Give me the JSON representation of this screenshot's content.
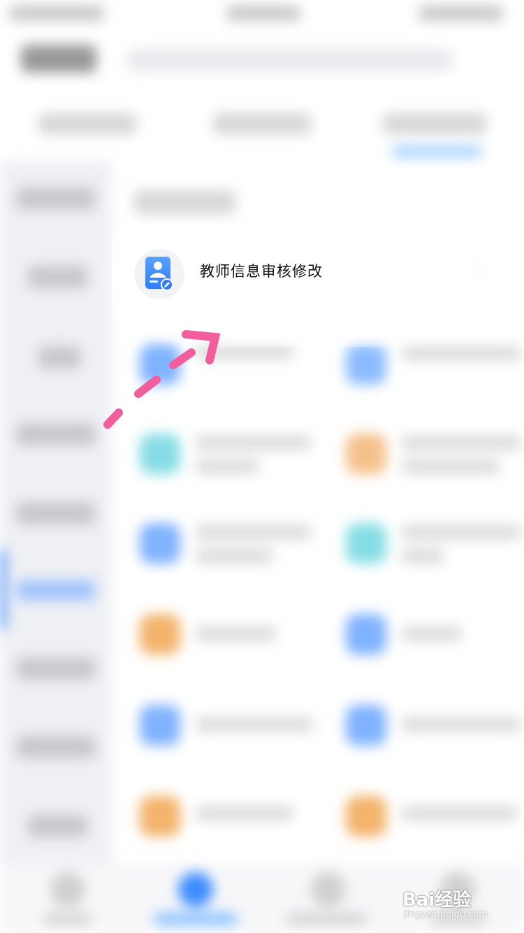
{
  "highlighted_item": {
    "label": "教师信息审核修改",
    "icon": "teacher-profile-edit-icon"
  },
  "annotation": {
    "type": "dashed-arrow",
    "color": "#f25d9c"
  },
  "watermark": {
    "brand": "Bai经验",
    "url": "jingyan.baidu.com"
  },
  "colors": {
    "accent_blue": "#3b82f6",
    "icon_gradient_top": "#5aa2ff",
    "icon_gradient_bottom": "#2f7cf6",
    "sidebar_bg": "#eef0f4"
  }
}
